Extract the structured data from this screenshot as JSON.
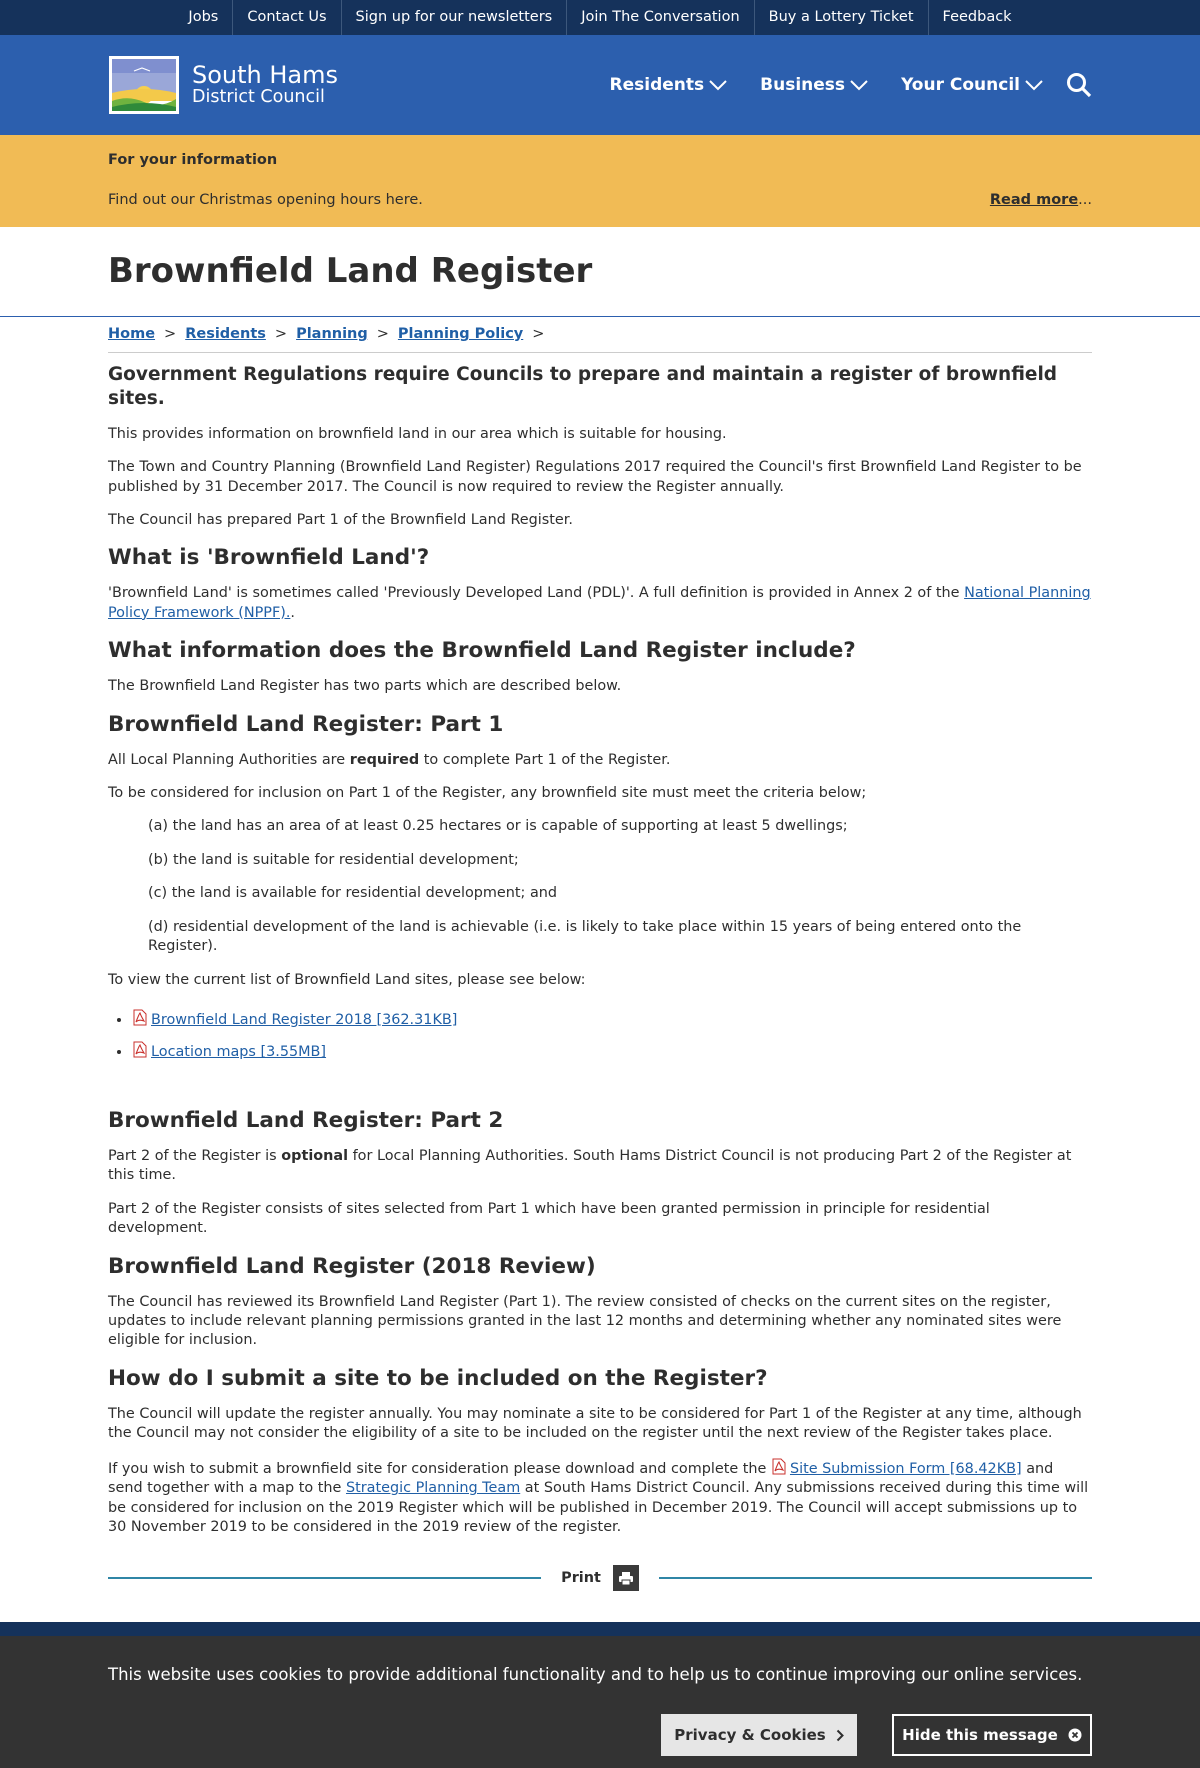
{
  "utility_links": [
    "Jobs",
    "Contact Us",
    "Sign up for our newsletters",
    "Join The Conversation",
    "Buy a Lottery Ticket",
    "Feedback"
  ],
  "logo": {
    "line1": "South Hams",
    "line2": "District Council"
  },
  "nav": {
    "residents": "Residents",
    "business": "Business",
    "council": "Your Council"
  },
  "banner": {
    "title": "For your information",
    "text": "Find out our Christmas opening hours here.",
    "read_more": "Read more",
    "ellipsis": "..."
  },
  "page_title": "Brownfield Land Register",
  "breadcrumb": [
    "Home",
    "Residents",
    "Planning",
    "Planning Policy"
  ],
  "breadcrumb_sep": ">",
  "intro": {
    "heading": "Government Regulations require Councils to prepare and maintain a register of brownfield sites.",
    "p1": "This provides information on brownfield land in our area which is suitable for housing.",
    "p2": "The Town and Country Planning (Brownfield Land Register) Regulations 2017 required the Council's first Brownfield Land Register to be published by 31 December 2017. The Council is now required to review the Register annually.",
    "p3": "The Council has prepared Part 1 of the Brownfield Land Register."
  },
  "what_is": {
    "heading": "What is 'Brownfield Land'?",
    "text": "'Brownfield Land' is sometimes called 'Previously Developed Land (PDL)'. A full definition is provided in Annex 2 of the ",
    "link": "National Planning Policy Framework (NPPF).",
    "after": "."
  },
  "what_info": {
    "heading": "What information does the Brownfield Land Register include?",
    "text": "The Brownfield Land Register has two parts which are described below."
  },
  "part1": {
    "heading": "Brownfield Land Register: Part 1",
    "p1_before": "All Local Planning Authorities are ",
    "p1_bold": "required",
    "p1_after": " to complete Part 1 of the Register.",
    "p2": "To be considered for inclusion on Part 1 of the Register, any brownfield site must meet the criteria below;",
    "criteria": [
      "(a) the land has an area of at least 0.25 hectares or is capable of supporting at least 5 dwellings;",
      "(b) the land is suitable for residential development;",
      "(c) the land is available for residential development; and",
      "(d) residential development of the land is achievable (i.e. is likely to take place within 15 years of being entered onto the Register)."
    ],
    "view_text": "To view the current list of Brownfield Land sites, please see below:",
    "downloads": [
      "Brownfield Land Register 2018 [362.31KB]",
      "Location maps [3.55MB]"
    ]
  },
  "part2": {
    "heading": "Brownfield Land Register: Part 2",
    "p1_before": "Part 2 of the Register is ",
    "p1_bold": "optional",
    "p1_after": " for Local Planning Authorities.  South Hams District Council is not producing Part 2 of the Register at this time.",
    "p2": "Part 2 of the Register consists of sites selected from Part 1 which have been granted permission in principle for residential development."
  },
  "review": {
    "heading": "Brownfield Land Register (2018 Review)",
    "text": "The Council has reviewed its Brownfield Land Register (Part 1). The review consisted of checks on the current sites on the register, updates to include relevant planning permissions granted in the last 12 months and determining whether any nominated sites were eligible for inclusion."
  },
  "submit": {
    "heading": "How do I submit a site to be included on the Register?",
    "p1": "The Council will update the register annually. You may nominate a site to be considered for Part 1 of the Register at any time, although the Council may not consider the eligibility of a site to be included on the register until the next review of the Register takes place.",
    "p2_a": "If you wish to submit a brownfield site for consideration please download and complete the ",
    "p2_link1": "Site Submission Form [68.42KB]",
    "p2_b": " and send together with a map to the ",
    "p2_link2": "Strategic Planning Team",
    "p2_c": " at South Hams District Council. Any submissions received during this time will be considered for inclusion on the 2019 Register which will be published in December 2019. The Council will accept submissions up to 30 November 2019 to be considered in the 2019 review of the register."
  },
  "print_label": "Print",
  "cookie": {
    "text": "This website uses cookies to provide additional functionality and to help us to continue improving our online services.",
    "privacy": "Privacy & Cookies",
    "hide": "Hide this message"
  },
  "colors": {
    "utility_bg": "#15325b",
    "header_bg": "#2c5fae",
    "banner_bg": "#f1bb55",
    "link": "#205fa6",
    "cookie_bg": "#333333"
  }
}
